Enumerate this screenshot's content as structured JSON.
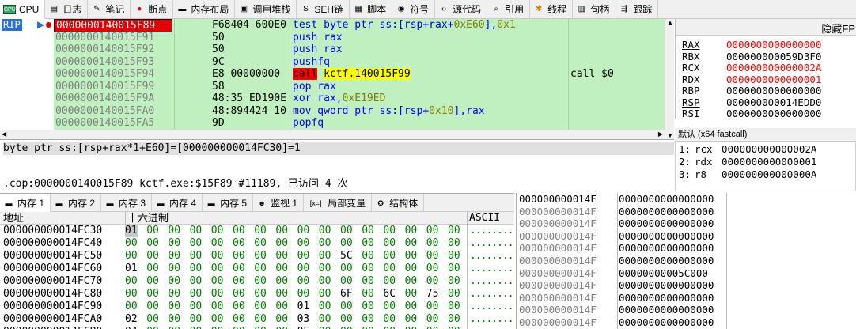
{
  "tabs": [
    {
      "label": "CPU",
      "icon": "cpu-icon"
    },
    {
      "label": "日志",
      "icon": "log-icon"
    },
    {
      "label": "笔记",
      "icon": "notes-icon"
    },
    {
      "label": "断点",
      "icon": "breakpoint-icon"
    },
    {
      "label": "内存布局",
      "icon": "memory-map-icon"
    },
    {
      "label": "调用堆栈",
      "icon": "call-stack-icon"
    },
    {
      "label": "SEH链",
      "icon": "seh-icon"
    },
    {
      "label": "脚本",
      "icon": "script-icon"
    },
    {
      "label": "符号",
      "icon": "symbols-icon"
    },
    {
      "label": "源代码",
      "icon": "source-icon"
    },
    {
      "label": "引用",
      "icon": "references-icon"
    },
    {
      "label": "线程",
      "icon": "threads-icon"
    },
    {
      "label": "句柄",
      "icon": "handles-icon"
    },
    {
      "label": "跟踪",
      "icon": "trace-icon"
    }
  ],
  "disasm": {
    "rip_label": "RIP",
    "rows": [
      {
        "addr": "0000000140015F89",
        "bytes": "F68404 600E0",
        "instr": "test byte ptr ss:[rsp+rax+0xE60],0x1",
        "comment": "",
        "current": true
      },
      {
        "addr": "0000000140015F91",
        "bytes": "50",
        "instr": "push rax",
        "comment": ""
      },
      {
        "addr": "0000000140015F92",
        "bytes": "50",
        "instr": "push rax",
        "comment": ""
      },
      {
        "addr": "0000000140015F93",
        "bytes": "9C",
        "instr": "pushfq",
        "comment": ""
      },
      {
        "addr": "0000000140015F94",
        "bytes": "E8 00000000",
        "instr": "call kctf.140015F99",
        "comment": "call $0",
        "call": true
      },
      {
        "addr": "0000000140015F99",
        "bytes": "58",
        "instr": "pop rax",
        "comment": ""
      },
      {
        "addr": "0000000140015F9A",
        "bytes": "48:35 ED190E",
        "instr": "xor rax,0xE19ED",
        "comment": ""
      },
      {
        "addr": "0000000140015FA0",
        "bytes": "48:894424 10",
        "instr": "mov qword ptr ss:[rsp+0x10],rax",
        "comment": ""
      },
      {
        "addr": "0000000140015FA5",
        "bytes": "9D",
        "instr": "popfq",
        "comment": ""
      }
    ]
  },
  "registers": {
    "header": "隐藏FP",
    "rows": [
      {
        "name": "RAX",
        "value": "0000000000000000",
        "changed": true
      },
      {
        "name": "RBX",
        "value": "000000000059D3F0",
        "changed": false
      },
      {
        "name": "RCX",
        "value": "000000000000002A",
        "changed": true
      },
      {
        "name": "RDX",
        "value": "0000000000000001",
        "changed": true
      },
      {
        "name": "RBP",
        "value": "0000000000000000",
        "changed": false
      },
      {
        "name": "RSP",
        "value": "000000000014EDD0",
        "changed": false
      },
      {
        "name": "RSI",
        "value": "0000000000000000",
        "changed": false
      }
    ]
  },
  "callconv": "默认 (x64 fastcall)",
  "args": [
    {
      "idx": "1:",
      "reg": "rcx",
      "value": "000000000000002A"
    },
    {
      "idx": "2:",
      "reg": "rdx",
      "value": "0000000000000001"
    },
    {
      "idx": "3:",
      "reg": "r8",
      "value": "000000000000000A"
    }
  ],
  "info": {
    "line1": "byte ptr ss:[rsp+rax*1+E60]=[000000000014FC30]=1",
    "line2": ".cop:0000000140015F89 kctf.exe:$15F89 #11189, 已访问 4 次"
  },
  "memtabs": [
    {
      "label": "内存 1",
      "icon": "memory-icon"
    },
    {
      "label": "内存 2",
      "icon": "memory-icon"
    },
    {
      "label": "内存 3",
      "icon": "memory-icon"
    },
    {
      "label": "内存 4",
      "icon": "memory-icon"
    },
    {
      "label": "内存 5",
      "icon": "memory-icon"
    },
    {
      "label": "监视 1",
      "icon": "watch-icon"
    },
    {
      "label": "局部变量",
      "icon": "locals-icon"
    },
    {
      "label": "结构体",
      "icon": "struct-icon"
    }
  ],
  "dump": {
    "col_addr": "地址",
    "col_hex": "十六进制",
    "col_ascii": "ASCII",
    "rows": [
      {
        "addr": "000000000014FC30",
        "hex": [
          "01",
          "00",
          "00",
          "00",
          "00",
          "00",
          "00",
          "00",
          "00",
          "00",
          "00",
          "00",
          "00",
          "00",
          "00",
          "00"
        ],
        "ascii": "........"
      },
      {
        "addr": "000000000014FC40",
        "hex": [
          "00",
          "00",
          "00",
          "00",
          "00",
          "00",
          "00",
          "00",
          "00",
          "00",
          "00",
          "00",
          "00",
          "00",
          "00",
          "00"
        ],
        "ascii": "........"
      },
      {
        "addr": "000000000014FC50",
        "hex": [
          "00",
          "00",
          "00",
          "00",
          "00",
          "00",
          "00",
          "00",
          "00",
          "00",
          "5C",
          "00",
          "00",
          "00",
          "00",
          "00"
        ],
        "ascii": "........"
      },
      {
        "addr": "000000000014FC60",
        "hex": [
          "01",
          "00",
          "00",
          "00",
          "00",
          "00",
          "00",
          "00",
          "00",
          "00",
          "00",
          "00",
          "00",
          "00",
          "00",
          "00"
        ],
        "ascii": "........"
      },
      {
        "addr": "000000000014FC70",
        "hex": [
          "00",
          "00",
          "00",
          "00",
          "00",
          "00",
          "00",
          "00",
          "00",
          "00",
          "00",
          "00",
          "00",
          "00",
          "00",
          "00"
        ],
        "ascii": "........"
      },
      {
        "addr": "000000000014FC80",
        "hex": [
          "00",
          "00",
          "00",
          "00",
          "00",
          "00",
          "00",
          "00",
          "00",
          "00",
          "6F",
          "00",
          "6C",
          "00",
          "75",
          "00"
        ],
        "ascii": "........"
      },
      {
        "addr": "000000000014FC90",
        "hex": [
          "00",
          "00",
          "00",
          "00",
          "00",
          "00",
          "00",
          "00",
          "01",
          "00",
          "00",
          "00",
          "00",
          "00",
          "00",
          "00"
        ],
        "ascii": "........"
      },
      {
        "addr": "000000000014FCA0",
        "hex": [
          "02",
          "00",
          "00",
          "00",
          "00",
          "00",
          "00",
          "00",
          "03",
          "00",
          "00",
          "00",
          "00",
          "00",
          "00",
          "00"
        ],
        "ascii": "........"
      },
      {
        "addr": "000000000014FCB0",
        "hex": [
          "04",
          "00",
          "00",
          "00",
          "00",
          "00",
          "00",
          "00",
          "05",
          "00",
          "00",
          "00",
          "00",
          "00",
          "00",
          "00"
        ],
        "ascii": "........"
      }
    ]
  },
  "stack": {
    "rows": [
      {
        "addr": "000000000014F",
        "value": "0000000000000000",
        "top": true
      },
      {
        "addr": "000000000014F",
        "value": "0000000000000000"
      },
      {
        "addr": "000000000014F",
        "value": "0000000000000000"
      },
      {
        "addr": "000000000014F",
        "value": "0000000000000000"
      },
      {
        "addr": "000000000014F",
        "value": "0000000000000000"
      },
      {
        "addr": "000000000014F",
        "value": "0000000000000000"
      },
      {
        "addr": "000000000014F",
        "value": "00000000005C000"
      },
      {
        "addr": "000000000014F",
        "value": "0000000000000000"
      },
      {
        "addr": "000000000014F",
        "value": "0000000000000000"
      },
      {
        "addr": "000000000014F",
        "value": "0000000000000000"
      },
      {
        "addr": "000000000014F",
        "value": "0000000000000000"
      }
    ]
  },
  "colors": {
    "addr_gray": "#808080",
    "changed_red": "#ff0000",
    "mnemonic_blue": "#0000ff",
    "hex_green": "#008000",
    "highlight_yellow": "#ffff00",
    "call_red": "#ff0000",
    "disasm_bg": "#c0f0c0",
    "current_bg": "#e00000"
  }
}
